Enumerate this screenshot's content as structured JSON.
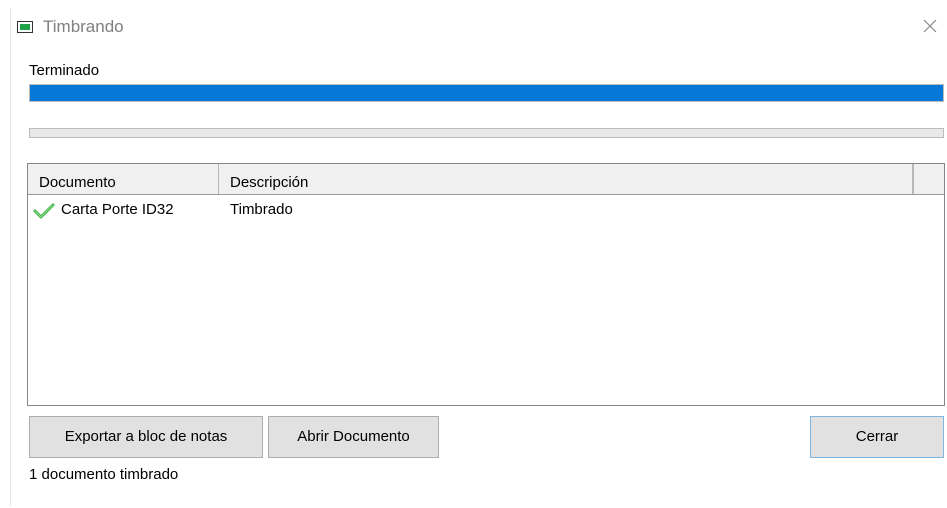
{
  "window": {
    "title": "Timbrando",
    "icon": "window-app-icon",
    "close_icon": "close-icon"
  },
  "status": {
    "label": "Terminado",
    "main_progress": 1.0,
    "secondary_progress": 0.0
  },
  "list": {
    "columns": [
      "Documento",
      "Descripción",
      ""
    ],
    "rows": [
      {
        "icon": "checkmark-icon",
        "documento": "Carta Porte ID32",
        "descripcion": "Timbrado"
      }
    ]
  },
  "buttons": {
    "export_label": "Exportar a bloc de notas",
    "open_label": "Abrir Documento",
    "close_label": "Cerrar"
  },
  "footer": {
    "status_text": "1 documento timbrado"
  },
  "colors": {
    "progress_fill": "#0678d7",
    "check_green": "#3cb043",
    "app_icon_green": "#1fa34a"
  }
}
